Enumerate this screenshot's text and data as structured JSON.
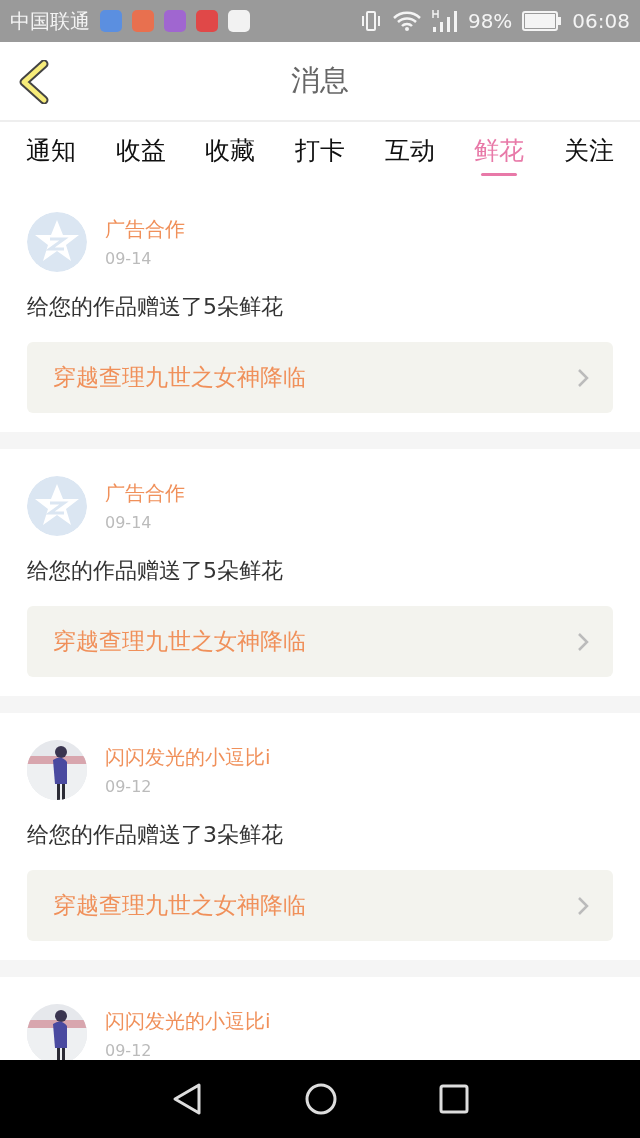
{
  "status_bar": {
    "carrier": "中国联通",
    "notifications": [
      {
        "color": "#5b8fe0"
      },
      {
        "color": "#e8704f"
      },
      {
        "color": "#a066d0"
      },
      {
        "color": "#e04848"
      },
      {
        "color": "#f2f2f2"
      }
    ],
    "battery": "98%",
    "time": "06:08"
  },
  "header": {
    "title": "消息"
  },
  "tabs": [
    {
      "label": "通知",
      "selected": false
    },
    {
      "label": "收益",
      "selected": false
    },
    {
      "label": "收藏",
      "selected": false
    },
    {
      "label": "打卡",
      "selected": false
    },
    {
      "label": "互动",
      "selected": false
    },
    {
      "label": "鲜花",
      "selected": true
    },
    {
      "label": "关注",
      "selected": false
    }
  ],
  "messages": [
    {
      "kind": "default",
      "name": "广告合作",
      "date": "09-14",
      "text": "给您的作品赠送了5朵鲜花",
      "link": "穿越查理九世之女神降临"
    },
    {
      "kind": "default",
      "name": "广告合作",
      "date": "09-14",
      "text": "给您的作品赠送了5朵鲜花",
      "link": "穿越查理九世之女神降临"
    },
    {
      "kind": "picture",
      "name": "闪闪发光的小逗比i",
      "date": "09-12",
      "text": "给您的作品赠送了3朵鲜花",
      "link": "穿越查理九世之女神降临"
    },
    {
      "kind": "picture",
      "name": "闪闪发光的小逗比i",
      "date": "09-12"
    }
  ]
}
